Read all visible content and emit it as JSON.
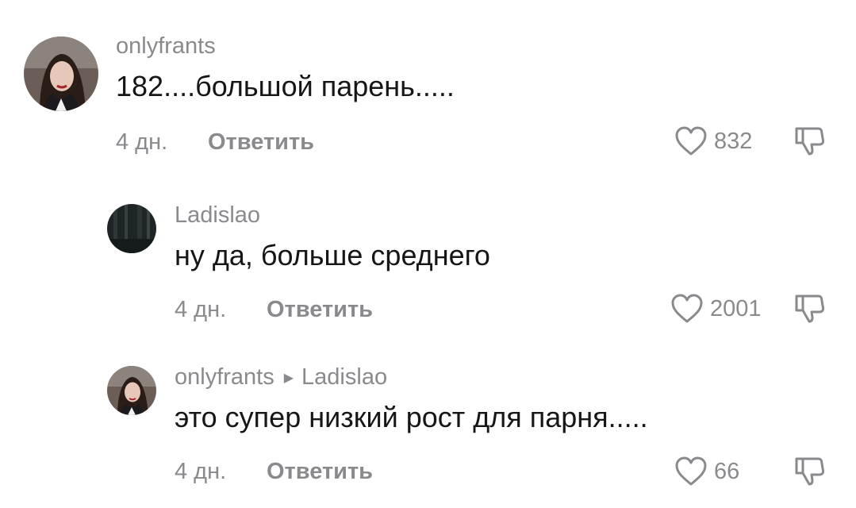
{
  "comments": [
    {
      "username": "onlyfrants",
      "text": "182....большой парень.....",
      "time": "4 дн.",
      "reply_label": "Ответить",
      "likes": "832",
      "avatar": "woman-portrait"
    },
    {
      "username": "Ladislao",
      "text": "ну да, больше среднего",
      "time": "4 дн.",
      "reply_label": "Ответить",
      "likes": "2001",
      "avatar": "dark-forest"
    },
    {
      "username": "onlyfrants",
      "reply_to": "Ladislao",
      "text": "это супер низкий рост для парня.....",
      "time": "4 дн.",
      "reply_label": "Ответить",
      "likes": "66",
      "avatar": "woman-portrait"
    }
  ],
  "icons": {
    "like": "heart-outline-icon",
    "dislike": "thumbs-down-outline-icon",
    "reply_arrow": "triangle-right-icon"
  },
  "colors": {
    "muted": "#8a8a8e",
    "text": "#161616",
    "background": "#ffffff"
  }
}
